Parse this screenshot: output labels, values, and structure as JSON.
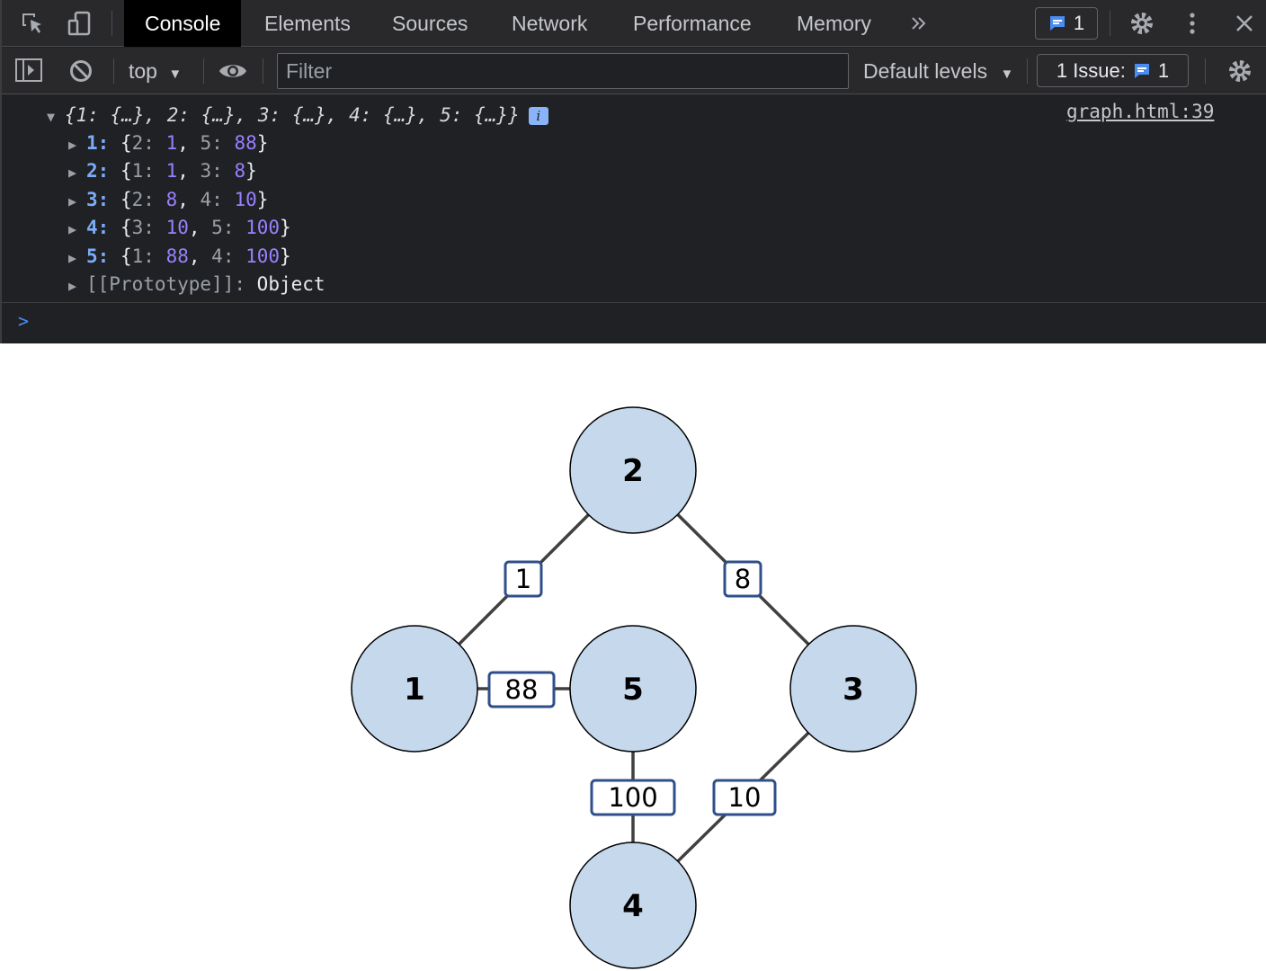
{
  "toolbar": {
    "tabs": [
      {
        "label": "Console",
        "active": true
      },
      {
        "label": "Elements",
        "active": false
      },
      {
        "label": "Sources",
        "active": false
      },
      {
        "label": "Network",
        "active": false
      },
      {
        "label": "Performance",
        "active": false
      },
      {
        "label": "Memory",
        "active": false
      }
    ],
    "more_tabs_icon": "double-chevron-right-icon",
    "messages_count": "1"
  },
  "filterbar": {
    "context": "top",
    "filter_placeholder": "Filter",
    "levels": "Default levels",
    "issues_label": "1 Issue:",
    "issues_count": "1"
  },
  "console": {
    "summary": "{1: {…}, 2: {…}, 3: {…}, 4: {…}, 5: {…}}",
    "source_link": "graph.html:39",
    "entries": [
      {
        "key": "1",
        "pairs": [
          {
            "k": "2",
            "v": "1"
          },
          {
            "k": "5",
            "v": "88"
          }
        ]
      },
      {
        "key": "2",
        "pairs": [
          {
            "k": "1",
            "v": "1"
          },
          {
            "k": "3",
            "v": "8"
          }
        ]
      },
      {
        "key": "3",
        "pairs": [
          {
            "k": "2",
            "v": "8"
          },
          {
            "k": "4",
            "v": "10"
          }
        ]
      },
      {
        "key": "4",
        "pairs": [
          {
            "k": "3",
            "v": "10"
          },
          {
            "k": "5",
            "v": "100"
          }
        ]
      },
      {
        "key": "5",
        "pairs": [
          {
            "k": "1",
            "v": "88"
          },
          {
            "k": "4",
            "v": "100"
          }
        ]
      }
    ],
    "prototype_key": "[[Prototype]]",
    "prototype_value": "Object"
  },
  "graph": {
    "colors": {
      "node_fill": "#c5d8ec",
      "node_stroke": "#000000",
      "edge": "#404040",
      "label_border": "#2f4f8a"
    },
    "nodes": [
      "1",
      "2",
      "3",
      "4",
      "5"
    ],
    "edges": [
      {
        "from": "2",
        "to": "1",
        "weight": "1"
      },
      {
        "from": "2",
        "to": "3",
        "weight": "8"
      },
      {
        "from": "1",
        "to": "5",
        "weight": "88"
      },
      {
        "from": "5",
        "to": "4",
        "weight": "100"
      },
      {
        "from": "3",
        "to": "4",
        "weight": "10"
      }
    ]
  }
}
